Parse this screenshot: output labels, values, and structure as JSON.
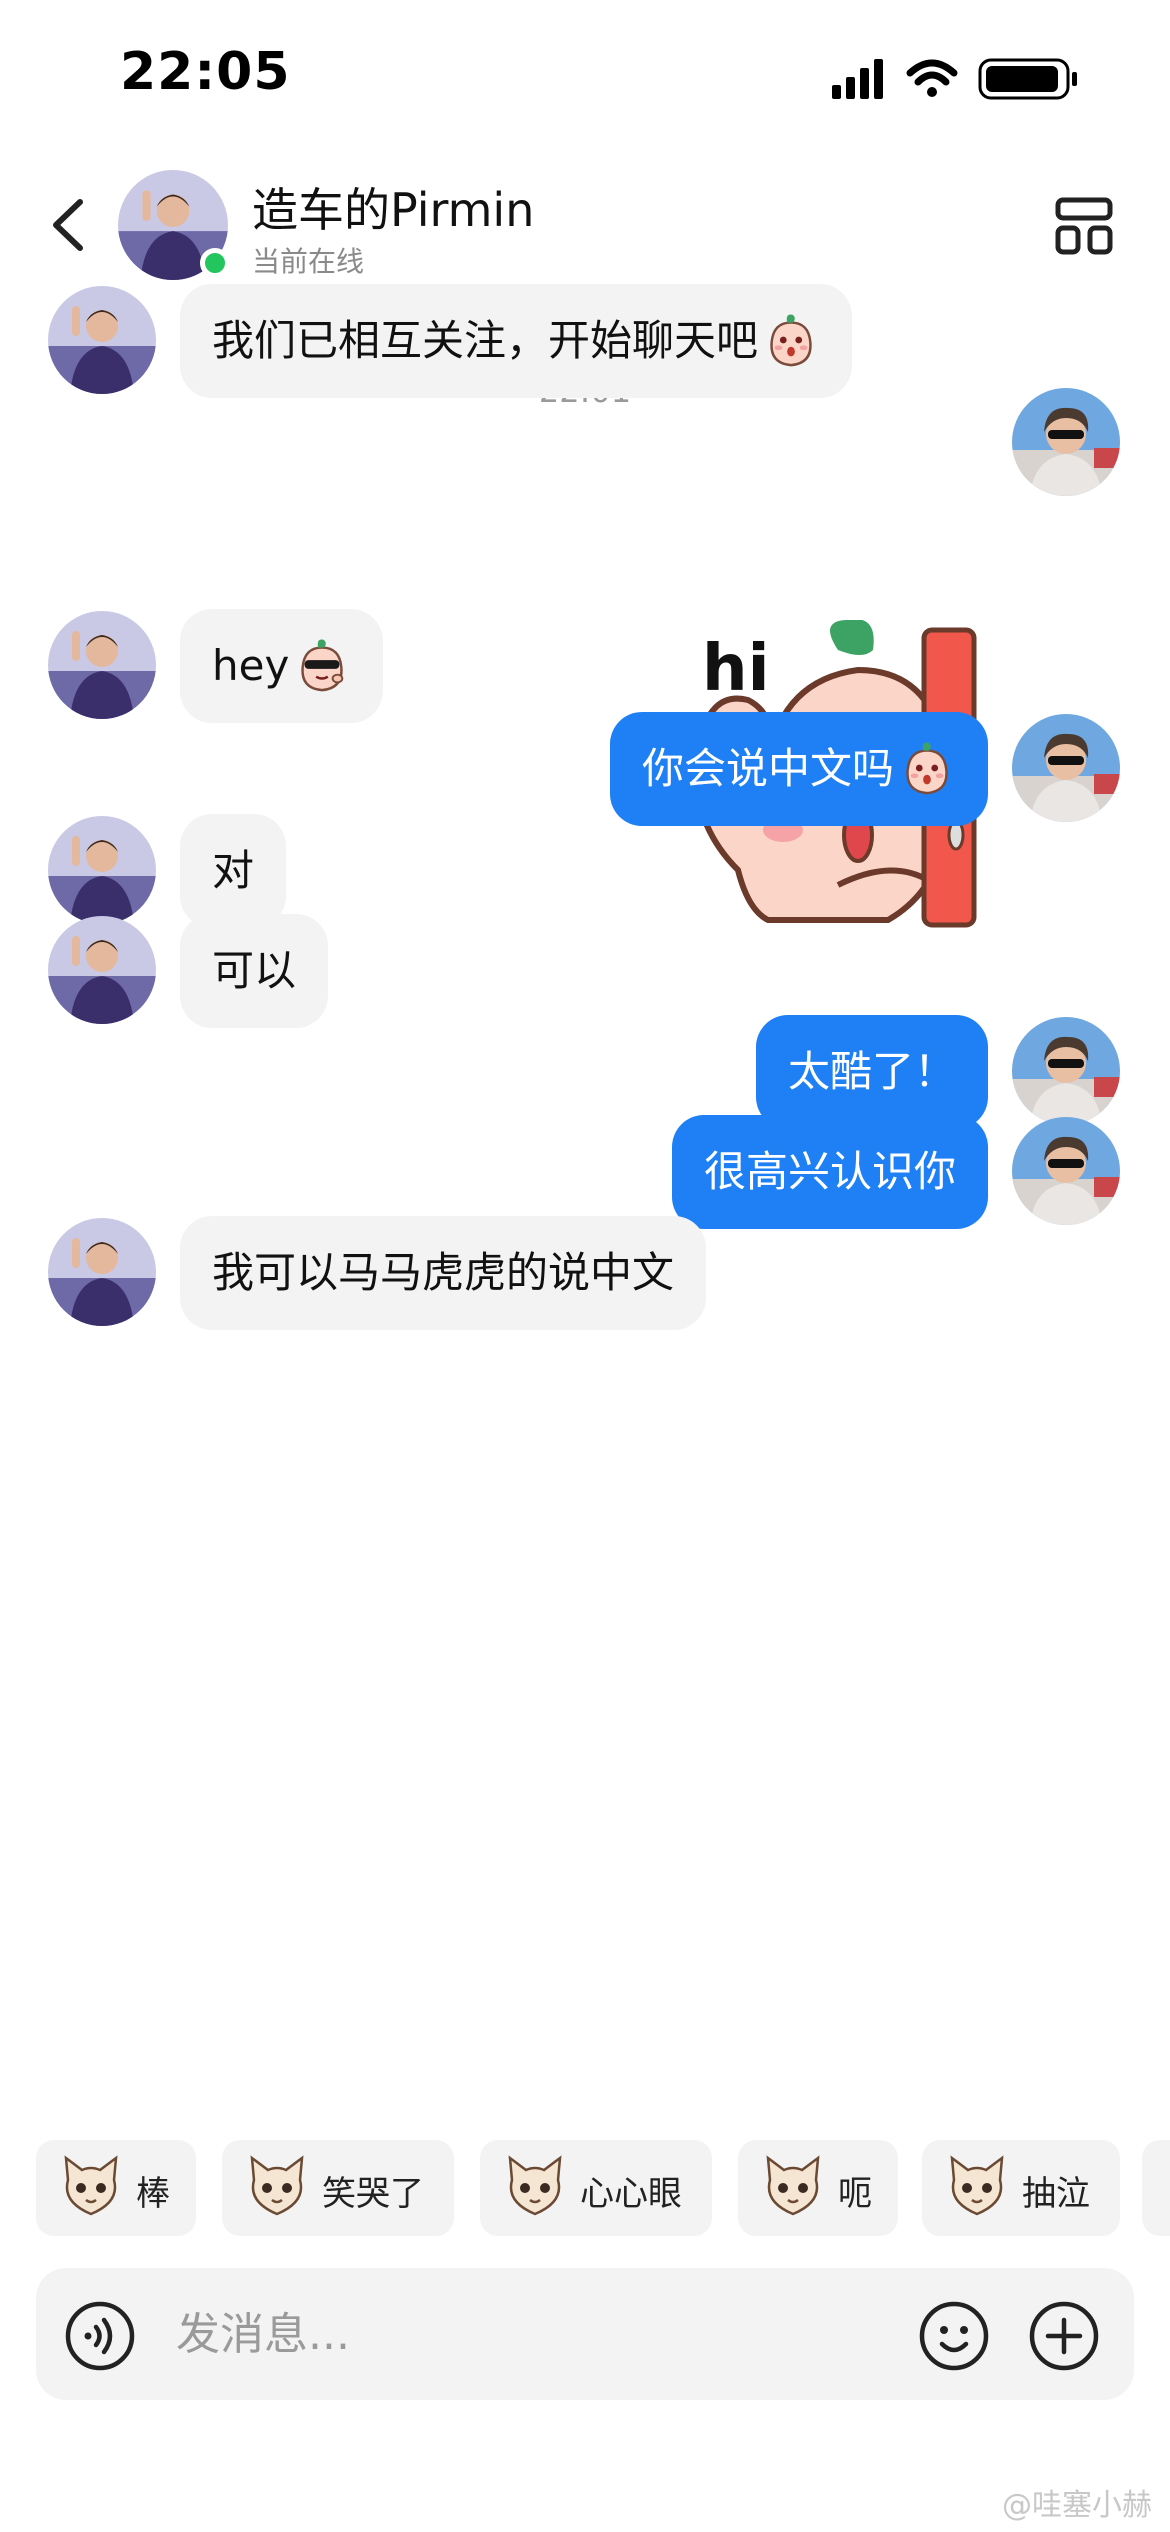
{
  "status_bar": {
    "time": "22:05"
  },
  "header": {
    "contact_name": "造车的Pirmin",
    "contact_status": "当前在线"
  },
  "timestamp": "22:01",
  "messages": [
    {
      "direction": "in",
      "text": "我们已相互关注，开始聊天吧",
      "emoji": "peach-emoji"
    },
    {
      "direction": "out",
      "type": "sticker",
      "sticker_text": "hi"
    },
    {
      "direction": "in",
      "text": "hey",
      "emoji": "peach-sunglasses-emoji"
    },
    {
      "direction": "out",
      "text": "你会说中文吗",
      "emoji": "peach-emoji"
    },
    {
      "direction": "in",
      "text": "对"
    },
    {
      "direction": "in",
      "text": "可以"
    },
    {
      "direction": "out",
      "text": "太酷了！"
    },
    {
      "direction": "out",
      "text": "很高兴认识你"
    },
    {
      "direction": "in",
      "text": "我可以马马虎虎的说中文"
    }
  ],
  "quick_reactions": [
    {
      "label": "棒",
      "icon": "thumbs-up-cat-icon"
    },
    {
      "label": "笑哭了",
      "icon": "laughing-cat-icon"
    },
    {
      "label": "心心眼",
      "icon": "heart-eyes-cat-icon"
    },
    {
      "label": "呃",
      "icon": "awkward-cat-icon"
    },
    {
      "label": "抽泣",
      "icon": "sobbing-cat-icon"
    }
  ],
  "input": {
    "placeholder": "发消息..."
  },
  "watermark": "@哇塞小赫",
  "colors": {
    "outgoing_bubble": "#1f80f5",
    "incoming_bubble": "#f3f3f3",
    "online_dot": "#22c55e"
  }
}
